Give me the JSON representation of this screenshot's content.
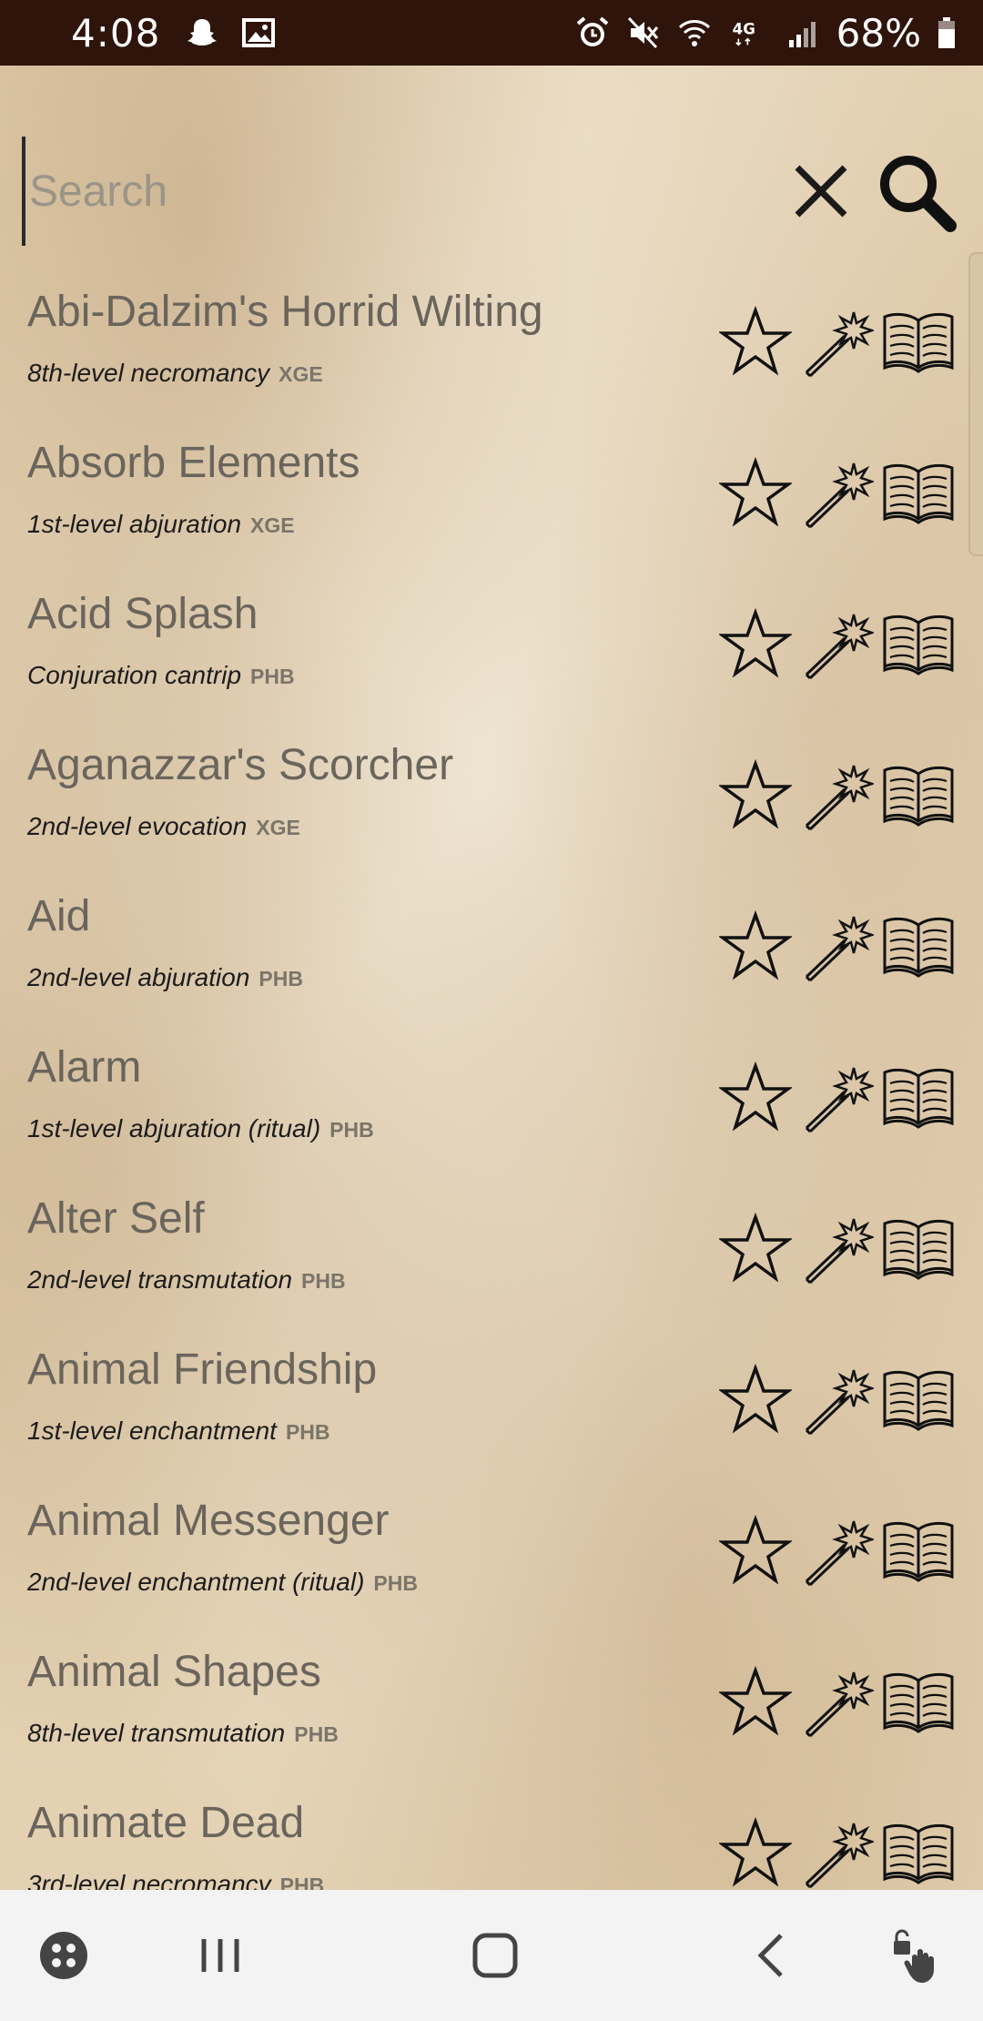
{
  "status_bar": {
    "time": "4:08",
    "battery_pct": "68%",
    "network": "4G",
    "icons": [
      "snapchat-icon",
      "gallery-icon",
      "alarm-icon",
      "mute-icon",
      "wifi-icon",
      "signal-icon",
      "battery-icon"
    ]
  },
  "search": {
    "placeholder": "Search",
    "value": ""
  },
  "spells": [
    {
      "name": "Abi-Dalzim's Horrid Wilting",
      "type": "8th-level necromancy",
      "source": "XGE"
    },
    {
      "name": "Absorb Elements",
      "type": "1st-level abjuration",
      "source": "XGE"
    },
    {
      "name": "Acid Splash",
      "type": "Conjuration cantrip",
      "source": "PHB"
    },
    {
      "name": "Aganazzar's Scorcher",
      "type": "2nd-level evocation",
      "source": "XGE"
    },
    {
      "name": "Aid",
      "type": "2nd-level abjuration",
      "source": "PHB"
    },
    {
      "name": "Alarm",
      "type": "1st-level abjuration (ritual)",
      "source": "PHB"
    },
    {
      "name": "Alter Self",
      "type": "2nd-level transmutation",
      "source": "PHB"
    },
    {
      "name": "Animal Friendship",
      "type": "1st-level enchantment",
      "source": "PHB"
    },
    {
      "name": "Animal Messenger",
      "type": "2nd-level enchantment (ritual)",
      "source": "PHB"
    },
    {
      "name": "Animal Shapes",
      "type": "8th-level transmutation",
      "source": "PHB"
    },
    {
      "name": "Animate Dead",
      "type": "3rd-level necromancy",
      "source": "PHB"
    }
  ],
  "row_actions": [
    "star-icon",
    "magic-wand-icon",
    "book-icon"
  ],
  "nav_bar": [
    "game-launcher-icon",
    "recent-apps-icon",
    "home-icon",
    "back-icon",
    "touch-lock-icon"
  ],
  "colors": {
    "status_bar_bg": "#2e140a",
    "name_text": "#6a655c",
    "nav_bg": "#f3f3f3"
  }
}
